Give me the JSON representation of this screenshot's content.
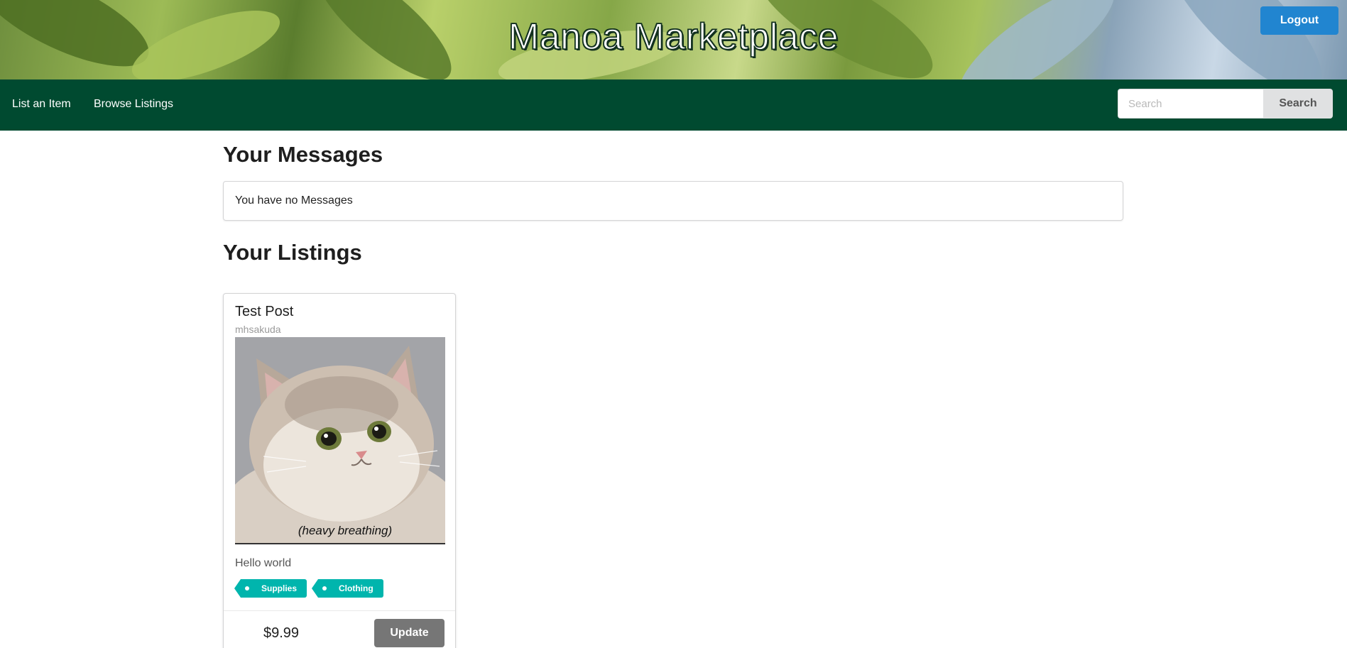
{
  "header": {
    "title": "Manoa Marketplace",
    "logout_label": "Logout"
  },
  "nav": {
    "items": [
      {
        "label": "List an Item"
      },
      {
        "label": "Browse Listings"
      }
    ],
    "search": {
      "placeholder": "Search",
      "value": "",
      "button_label": "Search"
    }
  },
  "main": {
    "messages": {
      "heading": "Your Messages",
      "empty_text": "You have no Messages"
    },
    "listings": {
      "heading": "Your Listings",
      "cards": [
        {
          "title": "Test Post",
          "owner": "mhsakuda",
          "image_caption": "(heavy breathing)",
          "description": "Hello world",
          "tags": [
            "Supplies",
            "Clothing"
          ],
          "price": "$9.99",
          "button_label": "Update"
        }
      ]
    }
  },
  "colors": {
    "nav_bg": "#004a30",
    "logout_bg": "#2185d0",
    "tag_bg": "#00b5ad",
    "update_bg": "#767676"
  }
}
